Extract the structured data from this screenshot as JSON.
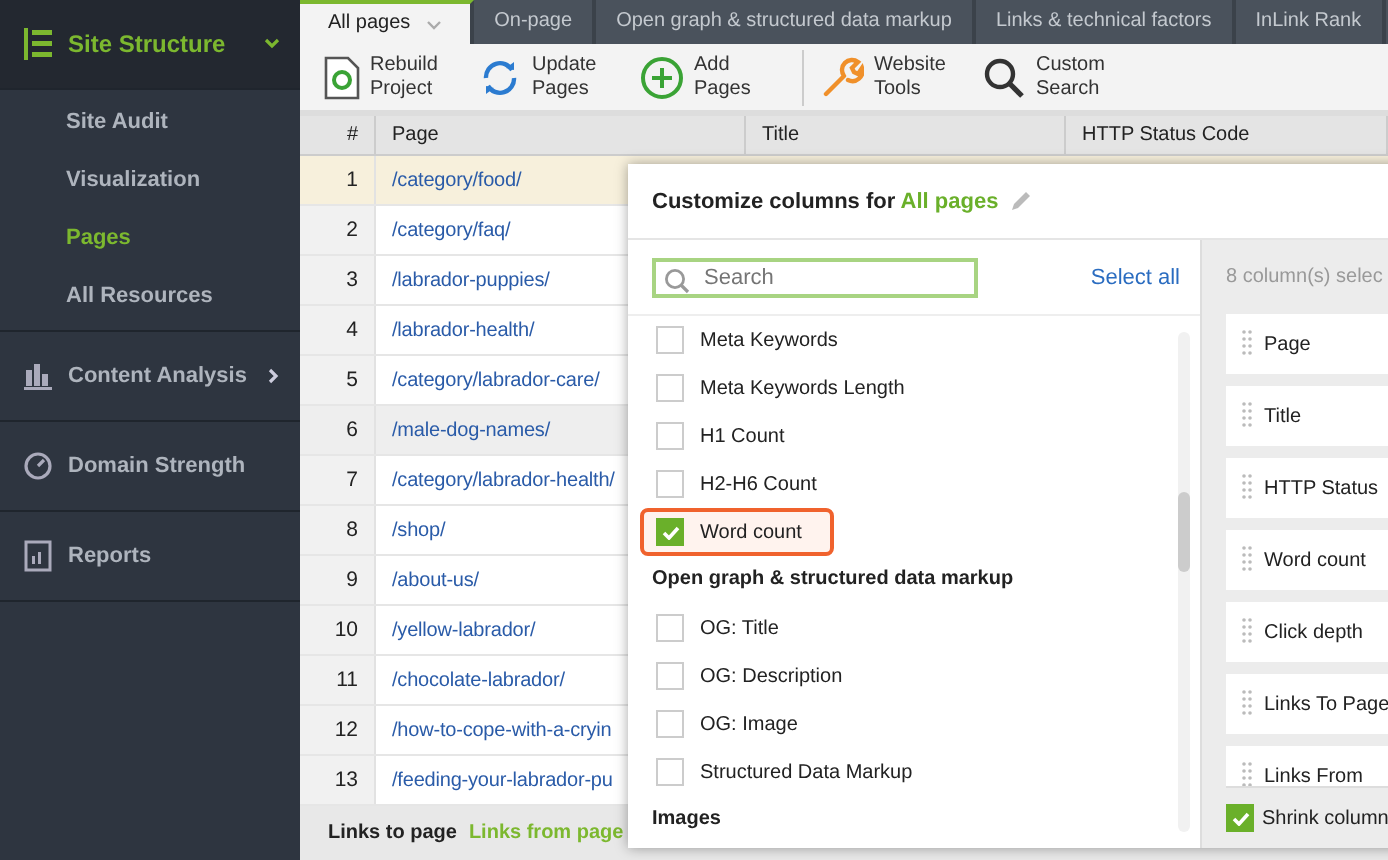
{
  "sidebar": {
    "sections": [
      {
        "label": "Site Structure",
        "expanded": true,
        "children": [
          {
            "label": "Site Audit",
            "selected": false
          },
          {
            "label": "Visualization",
            "selected": false
          },
          {
            "label": "Pages",
            "selected": true
          },
          {
            "label": "All Resources",
            "selected": false
          }
        ]
      },
      {
        "label": "Content Analysis",
        "expanded": false
      },
      {
        "label": "Domain Strength",
        "expanded": false
      },
      {
        "label": "Reports",
        "expanded": false
      }
    ]
  },
  "tabs": [
    {
      "label": "All pages",
      "selected": true
    },
    {
      "label": "On-page",
      "selected": false
    },
    {
      "label": "Open graph & structured data markup",
      "selected": false
    },
    {
      "label": "Links & technical factors",
      "selected": false
    },
    {
      "label": "InLink Rank",
      "selected": false
    }
  ],
  "toolbar": [
    {
      "label": "Rebuild Project"
    },
    {
      "label": "Update Pages"
    },
    {
      "label": "Add Pages"
    },
    {
      "label": "Website Tools"
    },
    {
      "label": "Custom Search"
    }
  ],
  "table": {
    "columns": [
      "#",
      "Page",
      "Title",
      "HTTP Status Code"
    ],
    "rows": [
      {
        "n": "1",
        "page": "/category/food/",
        "selected": true,
        "hovered": false
      },
      {
        "n": "2",
        "page": "/category/faq/",
        "selected": false,
        "hovered": false
      },
      {
        "n": "3",
        "page": "/labrador-puppies/",
        "selected": false,
        "hovered": false
      },
      {
        "n": "4",
        "page": "/labrador-health/",
        "selected": false,
        "hovered": false
      },
      {
        "n": "5",
        "page": "/category/labrador-care/",
        "selected": false,
        "hovered": false
      },
      {
        "n": "6",
        "page": "/male-dog-names/",
        "selected": false,
        "hovered": true
      },
      {
        "n": "7",
        "page": "/category/labrador-health/",
        "selected": false,
        "hovered": false
      },
      {
        "n": "8",
        "page": "/shop/",
        "selected": false,
        "hovered": false
      },
      {
        "n": "9",
        "page": "/about-us/",
        "selected": false,
        "hovered": false
      },
      {
        "n": "10",
        "page": "/yellow-labrador/",
        "selected": false,
        "hovered": false
      },
      {
        "n": "11",
        "page": "/chocolate-labrador/",
        "selected": false,
        "hovered": false
      },
      {
        "n": "12",
        "page": "/how-to-cope-with-a-cryin",
        "selected": false,
        "hovered": false
      },
      {
        "n": "13",
        "page": "/feeding-your-labrador-pu",
        "selected": false,
        "hovered": false
      }
    ],
    "footer_tabs": [
      {
        "label": "Links to page",
        "selected": true
      },
      {
        "label": "Links from page",
        "selected": false
      }
    ]
  },
  "popup": {
    "title": "Customize columns for",
    "title_highlight": "All pages",
    "search": {
      "placeholder": "Search"
    },
    "select_all": "Select all",
    "options": [
      {
        "kind": "option",
        "label": "Meta Keywords",
        "checked": false,
        "highlighted": false
      },
      {
        "kind": "option",
        "label": "Meta Keywords Length",
        "checked": false,
        "highlighted": false
      },
      {
        "kind": "option",
        "label": "H1 Count",
        "checked": false,
        "highlighted": false
      },
      {
        "kind": "option",
        "label": "H2-H6 Count",
        "checked": false,
        "highlighted": false
      },
      {
        "kind": "option",
        "label": "Word count",
        "checked": true,
        "highlighted": true
      },
      {
        "kind": "group",
        "label": "Open graph & structured data markup"
      },
      {
        "kind": "option",
        "label": "OG: Title",
        "checked": false,
        "highlighted": false
      },
      {
        "kind": "option",
        "label": "OG: Description",
        "checked": false,
        "highlighted": false
      },
      {
        "kind": "option",
        "label": "OG: Image",
        "checked": false,
        "highlighted": false
      },
      {
        "kind": "option",
        "label": "Structured Data Markup",
        "checked": false,
        "highlighted": false
      },
      {
        "kind": "group",
        "label": "Images"
      }
    ],
    "selected_count": "8 column(s) selec",
    "selected_columns": [
      "Page",
      "Title",
      "HTTP Status",
      "Word count",
      "Click depth",
      "Links To Page",
      "Links From"
    ],
    "shrink": {
      "label": "Shrink column",
      "checked": true
    }
  }
}
